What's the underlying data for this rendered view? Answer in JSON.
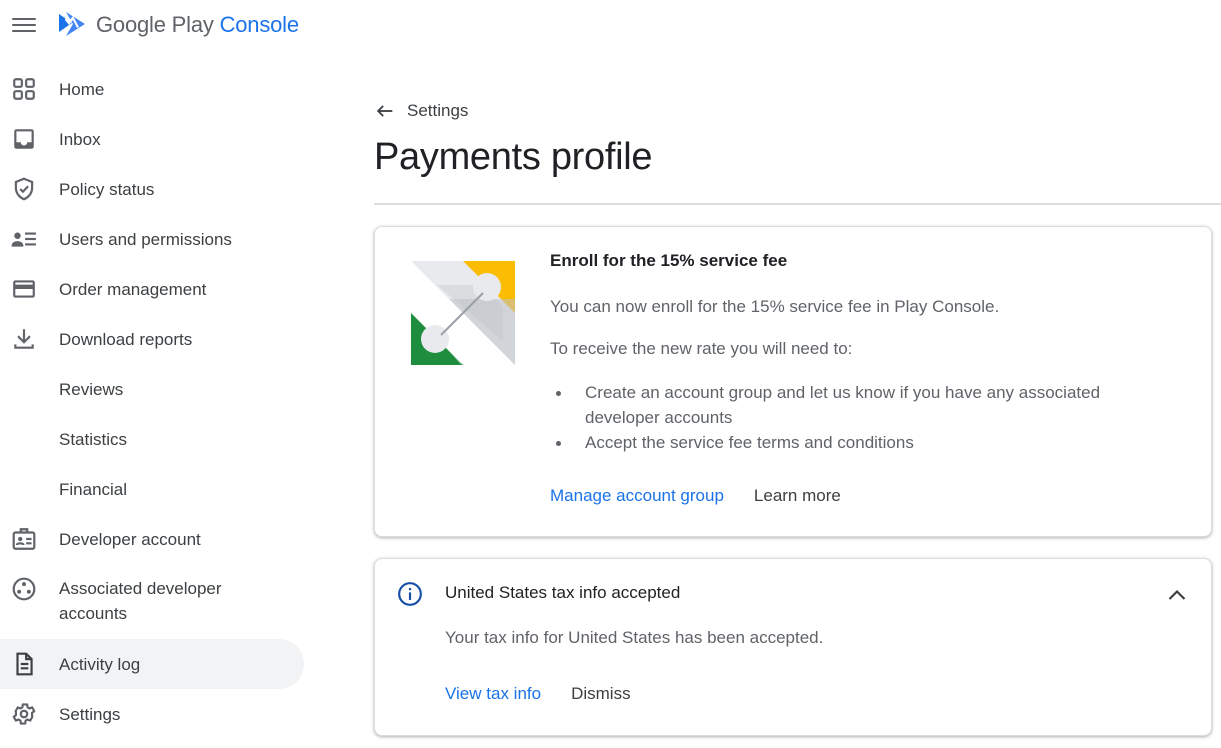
{
  "app": {
    "brand_main": "Google Play",
    "brand_accent": "Console",
    "accent_color": "#1a73e8"
  },
  "sidebar": {
    "items": [
      {
        "label": "Home",
        "icon": "home-grid-icon"
      },
      {
        "label": "Inbox",
        "icon": "inbox-icon"
      },
      {
        "label": "Policy status",
        "icon": "shield-check-icon"
      },
      {
        "label": "Users and permissions",
        "icon": "users-list-icon"
      },
      {
        "label": "Order management",
        "icon": "credit-card-icon"
      },
      {
        "label": "Download reports",
        "icon": "download-icon"
      },
      {
        "label": "Reviews"
      },
      {
        "label": "Statistics"
      },
      {
        "label": "Financial"
      },
      {
        "label": "Developer account",
        "icon": "id-badge-icon"
      },
      {
        "label": "Associated developer accounts",
        "icon": "associated-accounts-icon"
      },
      {
        "label": "Activity log",
        "icon": "document-icon",
        "active": true
      },
      {
        "label": "Settings",
        "icon": "gear-icon"
      }
    ]
  },
  "main": {
    "back_label": "Settings",
    "title": "Payments profile",
    "enroll_card": {
      "title": "Enroll for the 15% service fee",
      "p1": "You can now enroll for the 15% service fee in Play Console.",
      "p2": "To receive the new rate you will need to:",
      "bullets": [
        "Create an account group and let us know if you have any associated developer accounts",
        "Accept the service fee terms and conditions"
      ],
      "primary_action": "Manage account group",
      "secondary_action": "Learn more"
    },
    "tax_card": {
      "title": "United States tax info accepted",
      "message": "Your tax info for United States has been accepted.",
      "primary_action": "View tax info",
      "secondary_action": "Dismiss"
    }
  }
}
